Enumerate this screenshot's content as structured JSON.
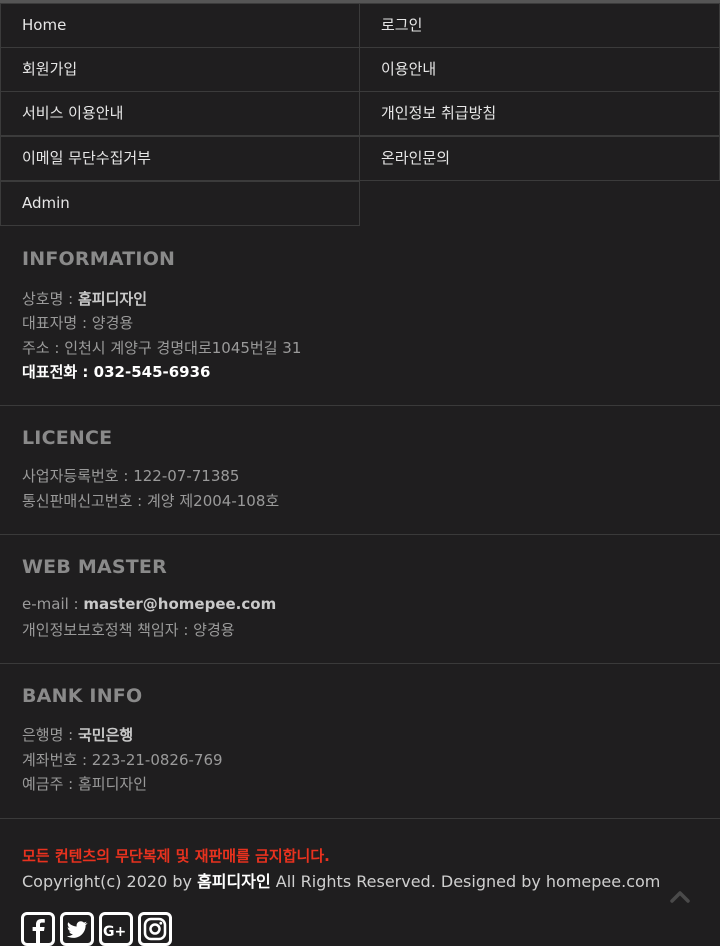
{
  "menu": {
    "items": [
      {
        "label": "Home"
      },
      {
        "label": "로그인"
      },
      {
        "label": "회원가입"
      },
      {
        "label": "이용안내"
      },
      {
        "label": "서비스 이용안내"
      },
      {
        "label": "개인정보 취급방침"
      },
      {
        "label": "이메일 무단수집거부"
      },
      {
        "label": "온라인문의"
      },
      {
        "label": "Admin"
      }
    ]
  },
  "information": {
    "title": "INFORMATION",
    "company_label": "상호명 : ",
    "company_value": "홈피디자인",
    "ceo_label": "대표자명 : ",
    "ceo_value": "양경용",
    "address_label": "주소 : ",
    "address_value": "인천시 계양구 경명대로1045번길 31",
    "phone_label": "대표전화 : ",
    "phone_value": "032-545-6936"
  },
  "licence": {
    "title": "LICENCE",
    "biz_label": "사업자등록번호 : ",
    "biz_value": "122-07-71385",
    "mail_order_label": "통신판매신고번호 : ",
    "mail_order_value": "계양 제2004-108호"
  },
  "webmaster": {
    "title": "WEB MASTER",
    "email_label": "e-mail : ",
    "email_value": "master@homepee.com",
    "privacy_label": "개인정보보호정책 책임자 : ",
    "privacy_value": "양경용"
  },
  "bank": {
    "title": "BANK INFO",
    "bank_label": "은행명 : ",
    "bank_value": "국민은행",
    "account_label": "계좌번호 : ",
    "account_value": "223-21-0826-769",
    "holder_label": "예금주 : ",
    "holder_value": "홈피디자인"
  },
  "footer": {
    "notice": "모든 컨텐츠의 무단복제 및 재판매를 금지합니다.",
    "copyright_prefix": "Copyright(c) 2020 by ",
    "copyright_brand": "홈피디자인",
    "copyright_suffix": " All Rights Reserved. Designed by homepee.com"
  },
  "icons": {
    "to_top": "chevron-up-icon",
    "social": [
      "facebook-icon",
      "twitter-icon",
      "google-plus-icon",
      "instagram-icon"
    ]
  },
  "colors": {
    "background": "#1f1e1f",
    "notice": "#e8321f",
    "border": "#3b3b3b"
  }
}
